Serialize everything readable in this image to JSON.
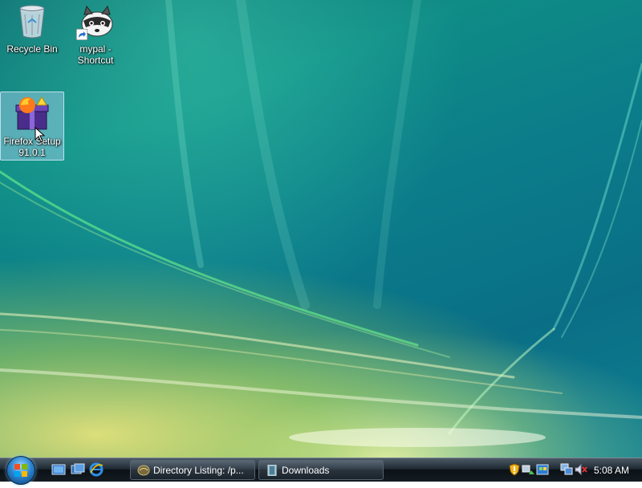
{
  "desktop": {
    "icons": [
      {
        "label_line1": "Recycle Bin",
        "label_line2": "",
        "glyph": "recycle-bin-icon",
        "selected": false
      },
      {
        "label_line1": "mypal -",
        "label_line2": "Shortcut",
        "glyph": "raccoon-icon",
        "selected": false
      },
      {
        "label_line1": "Firefox Setup",
        "label_line2": "91.0.1",
        "glyph": "firefox-setup-icon",
        "selected": true
      }
    ]
  },
  "taskbar": {
    "start_button": "windows-orb-icon",
    "quick_launch": [
      "show-desktop-icon",
      "switch-windows-icon",
      "internet-explorer-icon"
    ],
    "tasks": [
      {
        "label": "Directory Listing: /p...",
        "icon": "firefox-icon"
      },
      {
        "label": "Downloads",
        "icon": "downloads-icon"
      }
    ],
    "tray_icons": [
      "windows-security-icon",
      "network-icon",
      "update-icon",
      "network-connections-icon",
      "volume-muted-icon"
    ],
    "clock": "5:08 AM"
  },
  "colors": {
    "taskbar_dark": "#0b1116",
    "wallpaper_teal": "#0b7c8a",
    "selection": "#aad2f0"
  }
}
